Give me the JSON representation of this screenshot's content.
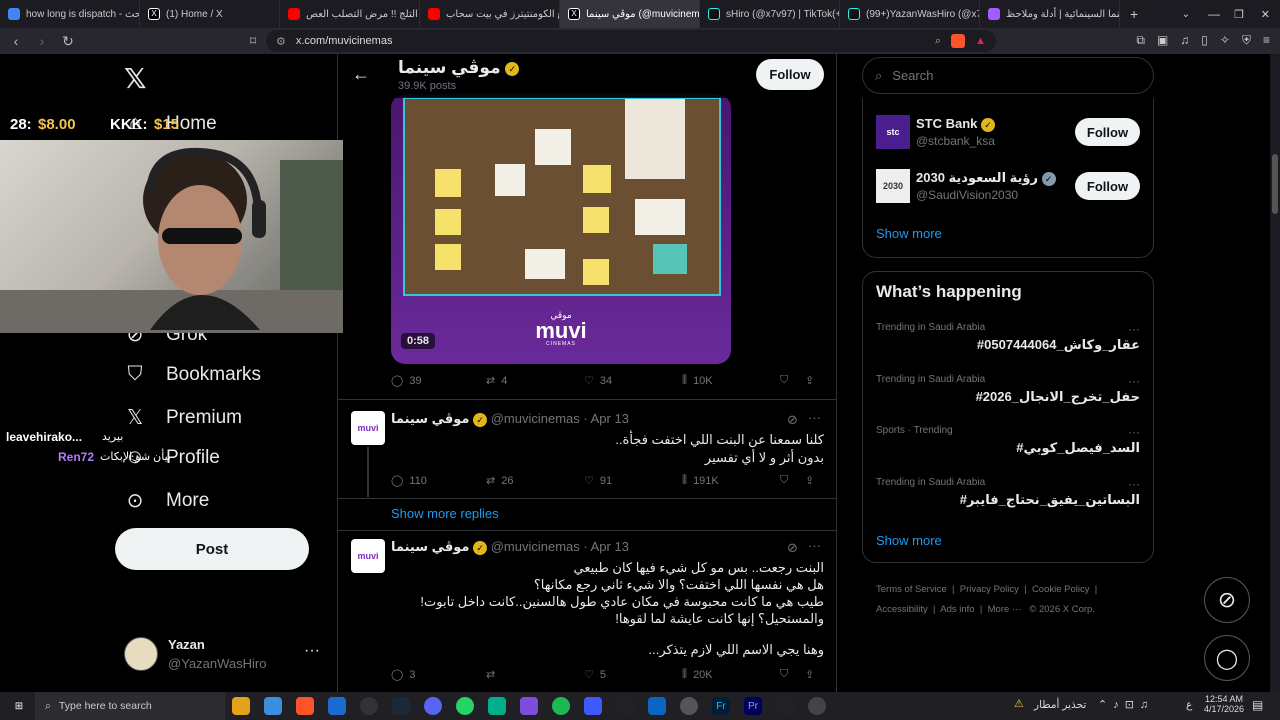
{
  "browser": {
    "tabs": [
      {
        "label": "how long is dispatch - بحث Go",
        "icon": "google-icon",
        "color": "#4285f4"
      },
      {
        "label": "(1) Home / X",
        "icon": "x-icon",
        "color": "#ffffff"
      },
      {
        "label": "تحدي التلج !! مرض التصلب العص",
        "icon": "youtube-icon",
        "color": "#ff0000"
      },
      {
        "label": "تجمع الكومنتيترز في بيت سحاب",
        "icon": "youtube-icon",
        "color": "#ff0000"
      },
      {
        "label": "موڤي سينما (@muvicinemas",
        "icon": "x-icon",
        "color": "#ffffff",
        "active": true
      },
      {
        "label": "sHiro (@x7v97) | TikTok(+99)",
        "icon": "tiktok-icon",
        "color": "#25f4ee"
      },
      {
        "label": "(99+)YazanWasHiro (@x7v97",
        "icon": "tiktok-icon",
        "color": "#25f4ee"
      },
      {
        "label": "السينما السينمائية | أدلة وملاحظ",
        "icon": "bookmark-icon",
        "color": "#a45cff"
      }
    ],
    "url": "x.com/muvicinemas"
  },
  "sidebar": {
    "items": [
      {
        "label": "Home",
        "icon": "home-icon"
      },
      {
        "label": "Grok",
        "icon": "grok-icon"
      },
      {
        "label": "Bookmarks",
        "icon": "bookmark-icon"
      },
      {
        "label": "Premium",
        "icon": "x-icon"
      },
      {
        "label": "Profile",
        "icon": "profile-icon"
      },
      {
        "label": "More",
        "icon": "more-icon"
      }
    ],
    "post_label": "Post",
    "user": {
      "name": "Yazan",
      "handle": "@YazanWasHiro"
    }
  },
  "stream_overlay": {
    "left_text": "28:",
    "left_value": "$8.00",
    "mid_text": "KKK:",
    "mid_value": "$15",
    "chat_user1": "leavehirako...",
    "chat_msg1": "بيريد",
    "chat_user2": "Ren72",
    "chat_msg2": "بيأن شو الإبكات"
  },
  "profile": {
    "name": "موڤي سينما",
    "posts": "39.9K posts",
    "follow_label": "Follow"
  },
  "video": {
    "duration": "0:58",
    "brand_ar": "موڤي",
    "brand": "muvi",
    "brand_sub": "CINEMAS"
  },
  "tweet0": {
    "replies": "39",
    "reposts": "4",
    "likes": "34",
    "views": "10K"
  },
  "tweet1": {
    "name": "موڤي سينما",
    "handle": "@muvicinemas",
    "date": "Apr 13",
    "lines": [
      "كلنا سمعنا عن البنت اللي اختفت فجأة..",
      "بدون أثر و لا أي تفسير"
    ],
    "replies": "110",
    "reposts": "26",
    "likes": "91",
    "views": "191K"
  },
  "show_more_replies": "Show more replies",
  "tweet2": {
    "name": "موڤي سينما",
    "handle": "@muvicinemas",
    "date": "Apr 13",
    "lines": [
      "البنت رجعت.. بس مو كل شيء فيها كان طبيعي",
      "هل هي نفسها اللي اختفت؟ والا شيء ثاني رجع مكانها؟",
      "طيب هي ما كانت محبوسة في مكان عادي طول هالسنين..كانت داخل تابوت!",
      "والمستحيل؟ إنها كانت عايشة لما لقوها!",
      "وهنا يجي الاسم اللي لازم يتذكر..."
    ],
    "replies": "3",
    "reposts": "",
    "likes": "5",
    "views": "20K"
  },
  "search": {
    "placeholder": "Search"
  },
  "who_to_follow": [
    {
      "name": "STC Bank",
      "handle": "@stcbank_ksa",
      "follow": "Follow",
      "avatar_text": "stc"
    },
    {
      "name": "رؤية السعودية 2030",
      "handle": "@SaudiVision2030",
      "follow": "Follow",
      "avatar_text": "2030"
    }
  ],
  "show_more": "Show more",
  "happening": {
    "title": "What’s happening",
    "trends": [
      {
        "meta": "Trending in Saudi Arabia",
        "name": "#عقار_وكاش_0507444064"
      },
      {
        "meta": "Trending in Saudi Arabia",
        "name": "#حفل_تخرج_الانجال_2026"
      },
      {
        "meta": "Sports · Trending",
        "name": "#السد_فيصل_كوبي"
      },
      {
        "meta": "Trending in Saudi Arabia",
        "name": "#البساتين_يفيق_نحتاج_فايبر"
      }
    ],
    "show_more": "Show more"
  },
  "footer": {
    "links": [
      "Terms of Service",
      "Privacy Policy",
      "Cookie Policy",
      "Accessibility",
      "Ads info",
      "More ···",
      "© 2026 X Corp."
    ]
  },
  "taskbar": {
    "search_placeholder": "Type here to search",
    "weather": "تحذير أمطار",
    "lang": "ع",
    "time": "12:54 AM",
    "date": "4/17/2026"
  }
}
